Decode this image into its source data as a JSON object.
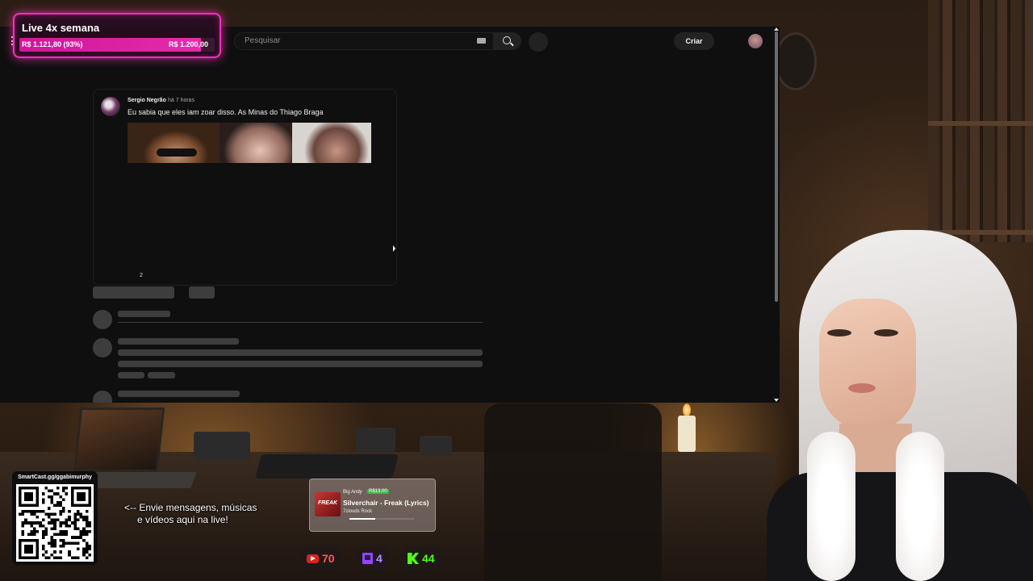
{
  "goal": {
    "title": "Live 4x semana",
    "current": "R$ 1.121,80 (93%)",
    "target": "R$ 1.200,00",
    "progress_fraction": 0.93
  },
  "youtube": {
    "search": {
      "placeholder": "Pesquisar"
    },
    "create_label": "Criar",
    "comment": {
      "author": "Sergio Negrão",
      "time": "há 7 horas",
      "text": "Eu sabia que eles iam zoar disso. As Minas do Thiago Braga",
      "likes": "2"
    }
  },
  "overlay": {
    "qr": {
      "title": "SmartCast.gg/ggabimurphy"
    },
    "hint": {
      "line1": "<-- Envie mensagens, músicas",
      "line2": "e vídeos aqui na live!"
    },
    "music": {
      "user": "Big Andy",
      "amount": "R$13,00",
      "title": "Silverchair - Freak (Lyrics)",
      "channel": "7clouds Rock",
      "album_text": "FREAK",
      "progress_fraction": 0.4
    },
    "viewers": {
      "youtube": "70",
      "twitch": "4",
      "kick": "44"
    }
  },
  "colors": {
    "goal_accent": "#ff2fb8",
    "youtube_red": "#e02020",
    "twitch_purple": "#9146ff",
    "kick_green": "#53fc18"
  }
}
